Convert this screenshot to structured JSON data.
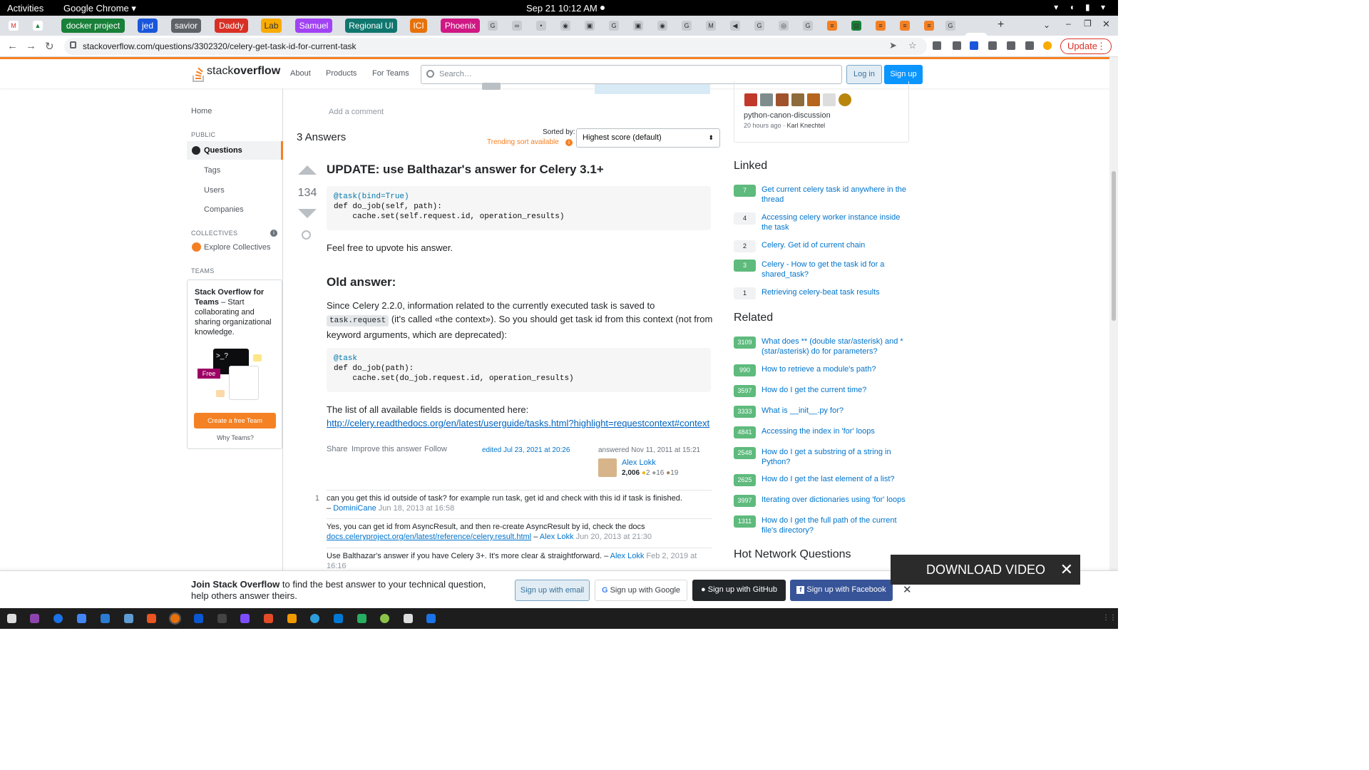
{
  "os_bar": {
    "activities": "Activities",
    "browser": "Google Chrome ▾",
    "clock": "Sep 21  10:12 AM"
  },
  "bookmarks": [
    "docker project",
    "jed",
    "savior",
    "Daddy",
    "Lab",
    "Samuel",
    "Regional UI",
    "ICI",
    "Phoenix"
  ],
  "bookmark_colors": [
    "#188038",
    "#1a56db",
    "#5f6368",
    "#d93025",
    "#f9ab00",
    "#a142f4",
    "#0f766e",
    "#e8710a",
    "#d01884"
  ],
  "active_tab": "p",
  "browser": {
    "url": "stackoverflow.com/questions/3302320/celery-get-task-id-for-current-task",
    "update": "Update"
  },
  "so_header": {
    "logo_stack": "stack",
    "logo_overflow": "overflow",
    "nav": [
      "About",
      "Products",
      "For Teams"
    ],
    "search_placeholder": "Search…",
    "login": "Log in",
    "signup": "Sign up"
  },
  "leftnav": {
    "home": "Home",
    "public": "PUBLIC",
    "questions": "Questions",
    "tags": "Tags",
    "users": "Users",
    "companies": "Companies",
    "collectives": "COLLECTIVES",
    "explore": "Explore Collectives",
    "teams": "TEAMS",
    "teams_title": "Stack Overflow for Teams",
    "teams_desc": " – Start collaborating and sharing organizational knowledge.",
    "free": "Free",
    "create_team": "Create a free Team",
    "why_teams": "Why Teams?"
  },
  "question": {
    "add_comment": "Add a comment"
  },
  "answers": {
    "count": "3 Answers",
    "sorted_by": "Sorted by:",
    "trending": "Trending sort available",
    "sort_value": "Highest score (default)"
  },
  "answer": {
    "score": "134",
    "h_update": "UPDATE: use Balthazar's answer for Celery 3.1+",
    "code1": [
      "@task(bind=True)",
      "def do_job(self, path):",
      "    cache.set(self.request.id, operation_results)"
    ],
    "p_upvote": "Feel free to upvote his answer.",
    "h_old": "Old answer:",
    "p_since_1": "Since Celery 2.2.0, information related to the currently executed task is saved to ",
    "p_since_code": "task.request",
    "p_since_2": " (it's called «the context»). So you should get task id from this context (not from keyword arguments, which are deprecated):",
    "code2": [
      "@task",
      "def do_job(path):",
      "    cache.set(do_job.request.id, operation_results)"
    ],
    "p_list": "The list of all available fields is documented here:",
    "doc_link": "http://celery.readthedocs.org/en/latest/userguide/tasks.html?highlight=requestcontext#context",
    "actions": [
      "Share",
      "Improve this answer",
      "Follow"
    ],
    "edited": "edited Jul 23, 2021 at 20:26",
    "answered": "answered Nov 11, 2011 at 15:21",
    "author": "Alex Lokk",
    "rep": "2,006",
    "badges": [
      "2",
      "16",
      "19"
    ]
  },
  "comments": [
    {
      "score": "1",
      "text": "can you get this id outside of task? for example run task, get id and check with this id if task is finished.",
      "dash": "–",
      "user": "DominiCane",
      "time": "Jun 18, 2013 at 16:58"
    },
    {
      "score": "",
      "text": "Yes, you can get id from AsyncResult, and then re-create AsyncResult by id, check the docs",
      "link": "docs.celeryproject.org/en/latest/reference/celery.result.html",
      "dash": "–",
      "user": "Alex Lokk",
      "time": "Jun 20, 2013 at 21:30"
    },
    {
      "score": "",
      "text": "Use Balthazar's answer if you have Celery 3+. It's more clear & straightforward.",
      "dash": "–",
      "user": "Alex Lokk",
      "time": "Feb 2, 2019 at 16:16"
    }
  ],
  "sidebar": {
    "meta_title": "python-canon-discussion",
    "meta_sub": "20 hours ago · ",
    "meta_user": "Karl Knechtel",
    "linked_title": "Linked",
    "linked": [
      {
        "score": "7",
        "title": "Get current celery task id anywhere in the thread",
        "accepted": true
      },
      {
        "score": "4",
        "title": "Accessing celery worker instance inside the task",
        "accepted": false
      },
      {
        "score": "2",
        "title": "Celery. Get id of current chain",
        "accepted": false
      },
      {
        "score": "3",
        "title": "Celery - How to get the task id for a shared_task?",
        "accepted": true
      },
      {
        "score": "1",
        "title": "Retrieving celery-beat task results",
        "accepted": false
      }
    ],
    "related_title": "Related",
    "related": [
      {
        "score": "3109",
        "title": "What does ** (double star/asterisk) and * (star/asterisk) do for parameters?"
      },
      {
        "score": "990",
        "title": "How to retrieve a module's path?"
      },
      {
        "score": "3597",
        "title": "How do I get the current time?"
      },
      {
        "score": "3333",
        "title": "What is __init__.py for?"
      },
      {
        "score": "4841",
        "title": "Accessing the index in 'for' loops"
      },
      {
        "score": "2548",
        "title": "How do I get a substring of a string in Python?"
      },
      {
        "score": "2625",
        "title": "How do I get the last element of a list?"
      },
      {
        "score": "3997",
        "title": "Iterating over dictionaries using 'for' loops"
      },
      {
        "score": "1311",
        "title": "How do I get the full path of the current file's directory?"
      }
    ],
    "hot_title": "Hot Network Questions"
  },
  "banner": {
    "bold": "Join Stack Overflow",
    "text": " to find the best answer to your technical question, help others answer theirs.",
    "email": "Sign up with email",
    "google": "Sign up with Google",
    "github": "Sign up with GitHub",
    "facebook": "Sign up with Facebook"
  },
  "overlay": {
    "label": "DOWNLOAD VIDEO"
  },
  "dock_colors": [
    "#ddd",
    "#8e44ad",
    "#1a73e8",
    "#4285f4",
    "#2b7bd3",
    "#5e9cd3",
    "#e95420",
    "#e8710a",
    "#0b57d0",
    "#444",
    "#7c4dff",
    "#e34c26",
    "#f29900",
    "#2d9cdb",
    "#0078d4",
    "#27ae60",
    "#8bc34a",
    "#ddd",
    "#1a73e8"
  ]
}
